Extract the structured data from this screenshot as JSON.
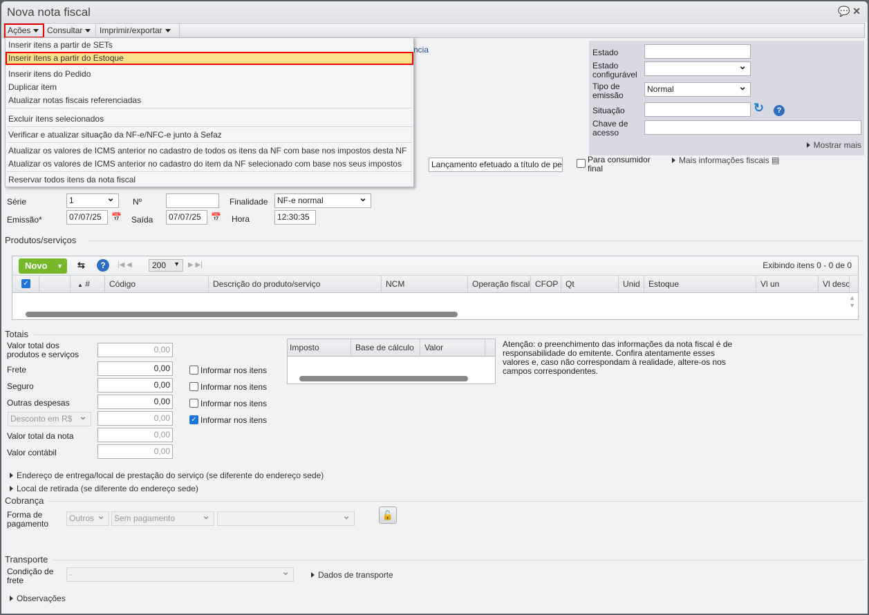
{
  "window": {
    "title": "Nova nota fiscal"
  },
  "toolbar": {
    "acoes": "Ações",
    "consultar": "Consultar",
    "imprimir": "Imprimir/exportar"
  },
  "menu": {
    "items": [
      "Inserir itens a partir de SETs",
      "Inserir itens a partir do Estoque",
      "Inserir itens do Pedido",
      "Duplicar item",
      "Atualizar notas fiscais referenciadas",
      "Excluir itens selecionados",
      "Verificar e atualizar situação da NF-e/NFC-e junto à Sefaz",
      "Atualizar os valores de ICMS anterior no cadastro de todos os itens da NF com base nos impostos desta NF",
      "Atualizar os valores de ICMS anterior no cadastro do item da NF selecionado com base nos seus impostos",
      "Reservar todos itens da nota fiscal"
    ]
  },
  "partial": {
    "ncia": "ncia"
  },
  "status_panel": {
    "estado": "Estado",
    "estado_config": "Estado configurável",
    "tipo_emissao": "Tipo de emissão",
    "tipo_emissao_value": "Normal",
    "situacao": "Situação",
    "chave": "Chave de acesso",
    "mostrar_mais": "Mostrar mais"
  },
  "fiscal": {
    "lancamento": "Lançamento efetuado a título de pe",
    "consumidor": "Para consumidor final",
    "mais_info": "Mais informações fiscais"
  },
  "header_fields": {
    "serie_label": "Série",
    "serie": "1",
    "numero_label": "Nº",
    "finalidade_label": "Finalidade",
    "finalidade": "NF-e normal",
    "emissao_label": "Emissão*",
    "emissao": "07/07/25",
    "saida_label": "Saída",
    "saida": "07/07/25",
    "hora_label": "Hora",
    "hora": "12:30:35"
  },
  "produtos": {
    "title": "Produtos/serviços",
    "novo": "Novo",
    "page_size": "200",
    "exibindo": "Exibindo itens 0 - 0 de 0",
    "columns": [
      "#",
      "Código",
      "Descrição do produto/serviço",
      "NCM",
      "Operação fiscal",
      "CFOP",
      "Qt",
      "Unid",
      "Estoque",
      "Vl un",
      "Vl desc"
    ]
  },
  "totais": {
    "title": "Totais",
    "rows": [
      {
        "label": "Valor total dos produtos e serviços",
        "value": "0,00"
      },
      {
        "label": "Frete",
        "value": "0,00",
        "check": "Informar nos itens"
      },
      {
        "label": "Seguro",
        "value": "0,00",
        "check": "Informar nos itens"
      },
      {
        "label": "Outras despesas",
        "value": "0,00",
        "check": "Informar nos itens"
      },
      {
        "label": "Desconto em R$",
        "value": "0,00",
        "check": "Informar nos itens"
      },
      {
        "label": "Valor total da nota",
        "value": "0,00"
      },
      {
        "label": "Valor contábil",
        "value": "0,00"
      }
    ],
    "tax_columns": [
      "Imposto",
      "Base de cálculo",
      "Valor"
    ],
    "atencao": "Atenção: o preenchimento das informações da nota fiscal é de responsabilidade do emitente. Confira atentamente esses valores e, caso não correspondam à realidade, altere-os nos campos correspondentes."
  },
  "links": {
    "endereco": "Endereço de entrega/local de prestação do serviço (se diferente do endereço sede)",
    "retirada": "Local de retirada (se diferente do endereço sede)",
    "observacoes": "Observações"
  },
  "cobranca": {
    "title": "Cobrança",
    "forma_label": "Forma de pagamento",
    "forma": "Outros",
    "pagamento": "Sem pagamento"
  },
  "transporte": {
    "title": "Transporte",
    "condicao_label": "Condição de frete",
    "condicao": "-",
    "dados": "Dados de transporte"
  }
}
